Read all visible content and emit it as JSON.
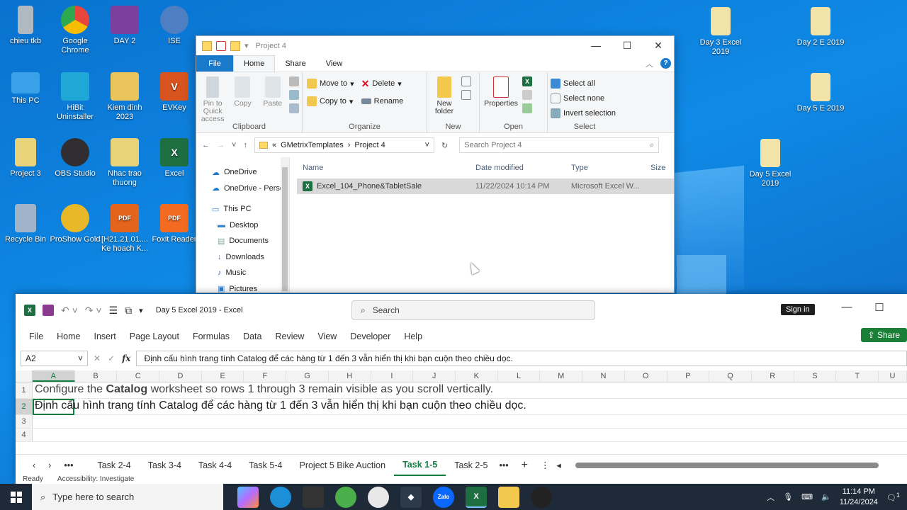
{
  "desktop": {
    "icons": [
      {
        "label": "chieu tkb",
        "color": "#b0b8c0"
      },
      {
        "label": "Google Chrome",
        "color": "#e8453c"
      },
      {
        "label": "DAY 2",
        "color": "#7b3fa0"
      },
      {
        "label": "ISE",
        "color": "#4d7fc2"
      },
      {
        "label": "This PC",
        "color": "#3aa0e8"
      },
      {
        "label": "HiBit Uninstaller",
        "color": "#1fa7d6"
      },
      {
        "label": "Kiem dinh 2023",
        "color": "#e8c45a"
      },
      {
        "label": "EVKey",
        "color": "#d9531e"
      },
      {
        "label": "Project 3",
        "color": "#e8d27a"
      },
      {
        "label": "OBS Studio",
        "color": "#302e31"
      },
      {
        "label": "Nhac trao thuong",
        "color": "#e8d27a"
      },
      {
        "label": "Excel",
        "color": "#1d6f42"
      },
      {
        "label": "Recycle Bin",
        "color": "#9fb4c8"
      },
      {
        "label": "ProShow Gold",
        "color": "#e8b828"
      },
      {
        "label": "[H21.21.01.... Ke hoach K...",
        "color": "#e4641c"
      },
      {
        "label": "Foxit Reader",
        "color": "#f26b21"
      },
      {
        "label": "Day 3 Excel 2019",
        "color": "#f2e4a8"
      },
      {
        "label": "Day 2 E 2019",
        "color": "#f2e4a8"
      },
      {
        "label": "Day 5 E 2019",
        "color": "#f2e4a8"
      },
      {
        "label": "Day 5 Excel 2019",
        "color": "#f2e4a8"
      }
    ]
  },
  "explorer": {
    "title": "Project 4",
    "tabs": [
      "File",
      "Home",
      "Share",
      "View"
    ],
    "clipboard": {
      "pin": "Pin to Quick access",
      "copy": "Copy",
      "paste": "Paste",
      "label": "Clipboard"
    },
    "organize": {
      "move": "Move to",
      "copy_to": "Copy to",
      "delete": "Delete",
      "rename": "Rename",
      "label": "Organize"
    },
    "new": {
      "folder": "New folder",
      "label": "New"
    },
    "open": {
      "properties": "Properties",
      "label": "Open"
    },
    "select": {
      "all": "Select all",
      "none": "Select none",
      "invert": "Invert selection",
      "label": "Select"
    },
    "path": [
      "GMetrixTemplates",
      "Project 4"
    ],
    "path_prefix": "«",
    "search_placeholder": "Search Project 4",
    "nav_items": [
      "OneDrive",
      "OneDrive - Person",
      "This PC",
      "Desktop",
      "Documents",
      "Downloads",
      "Music",
      "Pictures"
    ],
    "columns": [
      "Name",
      "Date modified",
      "Type",
      "Size"
    ],
    "files": [
      {
        "name": "Excel_104_Phone&TabletSale",
        "modified": "11/22/2024 10:14 PM",
        "type": "Microsoft Excel W..."
      }
    ]
  },
  "excel": {
    "title": "Day 5 Excel 2019  -  Excel",
    "search": "Search",
    "signin": "Sign in",
    "menu": [
      "File",
      "Home",
      "Insert",
      "Page Layout",
      "Formulas",
      "Data",
      "Review",
      "View",
      "Developer",
      "Help"
    ],
    "share": "Share",
    "namebox": "A2",
    "formula": "Định cấu hình trang tính Catalog để các hàng từ 1 đến 3 vẫn hiển thị khi bạn cuộn theo chiều dọc.",
    "columns": [
      "A",
      "B",
      "C",
      "D",
      "E",
      "F",
      "G",
      "H",
      "I",
      "J",
      "K",
      "L",
      "M",
      "N",
      "O",
      "P",
      "Q",
      "R",
      "S",
      "T",
      "U"
    ],
    "row1": {
      "pre": "Configure the ",
      "bold": "Catalog",
      "post": " worksheet so rows 1 through 3 remain visible as you scroll vertically."
    },
    "row2": "Định cấu hình trang tính Catalog để các hàng từ 1 đến 3 vẫn hiển thị khi bạn cuộn theo chiều dọc.",
    "row_numbers": [
      "1",
      "2",
      "3",
      "4"
    ],
    "sheet_tabs": [
      "Task 2-4",
      "Task 3-4",
      "Task 4-4",
      "Task 5-4",
      "Project 5 Bike Auction",
      "Task 1-5",
      "Task 2-5"
    ],
    "active_tab": "Task 1-5",
    "status": [
      "Ready",
      "Accessibility: Investigate"
    ]
  },
  "taskbar": {
    "search_placeholder": "Type here to search",
    "time": "11:14 PM",
    "date": "11/24/2024",
    "notification_count": "1"
  }
}
